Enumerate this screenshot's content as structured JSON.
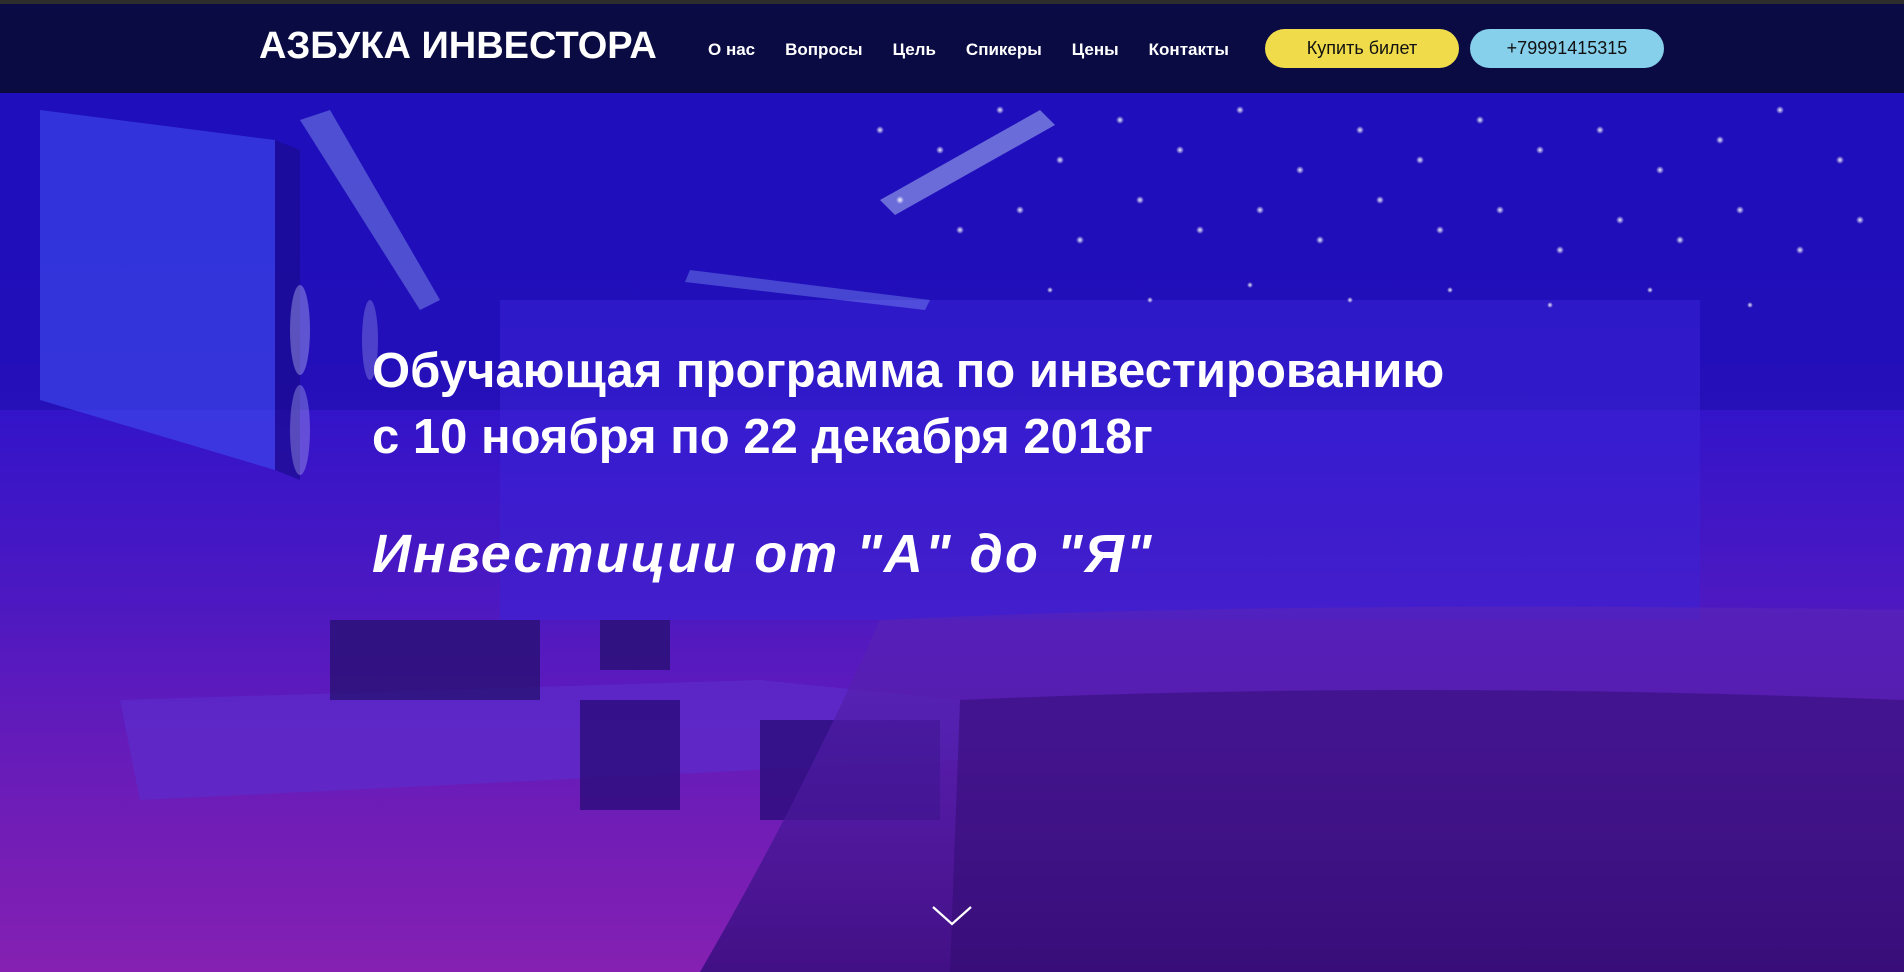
{
  "header": {
    "logo": "АЗБУКА ИНВЕСТОРА",
    "nav": [
      {
        "label": "О нас"
      },
      {
        "label": "Вопросы"
      },
      {
        "label": "Цель"
      },
      {
        "label": "Спикеры"
      },
      {
        "label": "Цены"
      },
      {
        "label": "Контакты"
      }
    ],
    "buy_ticket_label": "Купить билет",
    "phone_label": "+79991415315"
  },
  "hero": {
    "title_line1": "Обучающая программа по инвестированию",
    "title_line2": "с 10 ноября по 22 декабря 2018г",
    "subtitle": "Инвестиции от \"А\" до \"Я\"",
    "scroll_icon": "chevron-down-icon"
  },
  "colors": {
    "nav_background": "#080a30",
    "ticket_button": "#f0dc4a",
    "phone_button": "#86d0ec",
    "hero_overlay_top": "#1f10d4",
    "hero_overlay_bottom": "#8520b2",
    "text": "#ffffff"
  }
}
